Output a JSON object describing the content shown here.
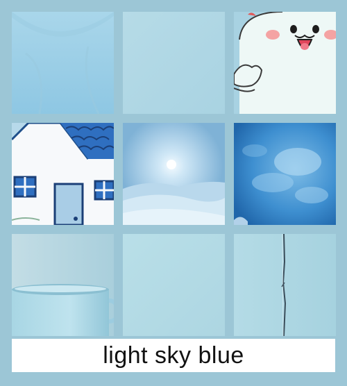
{
  "caption": "light sky blue",
  "colors": {
    "background": "#9cc6d6",
    "caption_bar": "#ffffff",
    "caption_text": "#111111"
  },
  "tiles": [
    {
      "subject": "t-shirt-fabric"
    },
    {
      "subject": "plain-swatch"
    },
    {
      "subject": "cartoon-ghost"
    },
    {
      "subject": "cartoon-house"
    },
    {
      "subject": "snowy-dunes"
    },
    {
      "subject": "blue-clouds"
    },
    {
      "subject": "mug"
    },
    {
      "subject": "plain-swatch"
    },
    {
      "subject": "wall-with-crack"
    }
  ]
}
